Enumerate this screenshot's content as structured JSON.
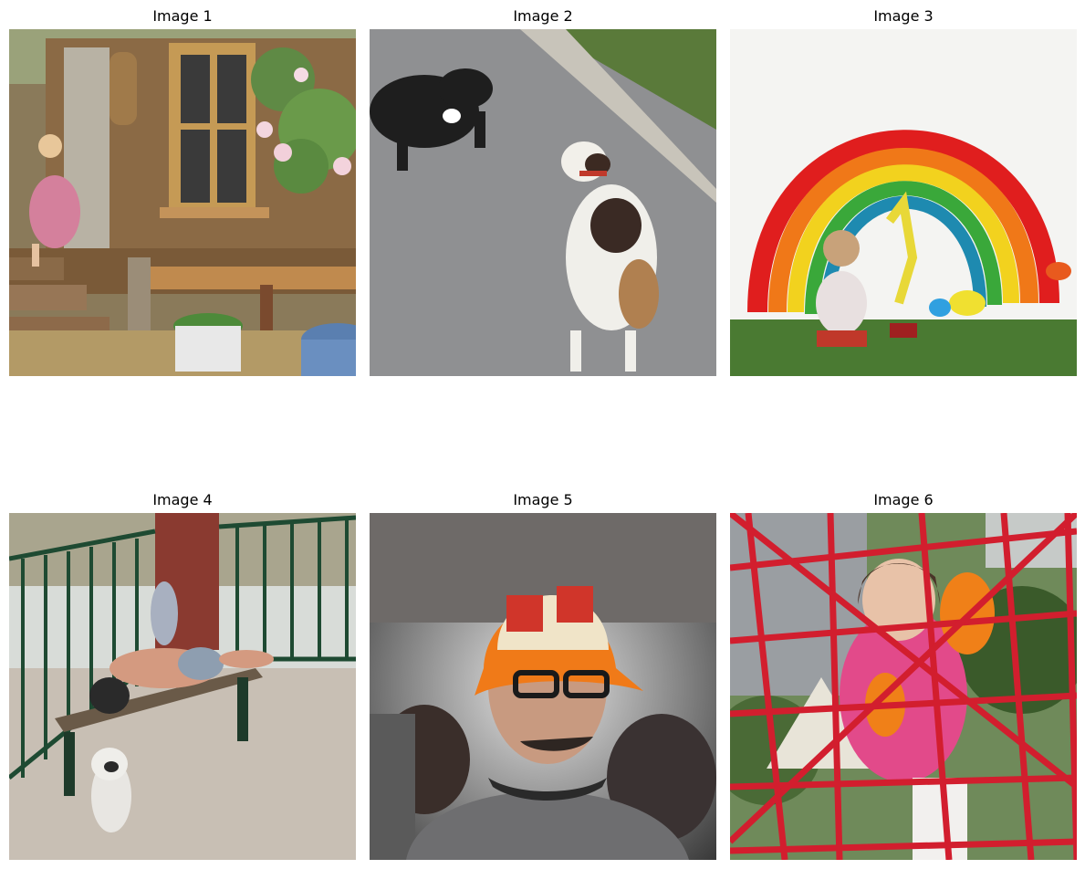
{
  "panels": [
    {
      "title": "Image 1",
      "icon": "girl-climbing-steps-of-wooden-cabin"
    },
    {
      "title": "Image 2",
      "icon": "two-dogs-on-road"
    },
    {
      "title": "Image 3",
      "icon": "child-in-front-of-painted-rainbow"
    },
    {
      "title": "Image 4",
      "icon": "man-lying-on-bench-with-dog"
    },
    {
      "title": "Image 5",
      "icon": "man-in-crocheted-hat"
    },
    {
      "title": "Image 6",
      "icon": "girl-on-red-rope-climbing-net"
    }
  ]
}
